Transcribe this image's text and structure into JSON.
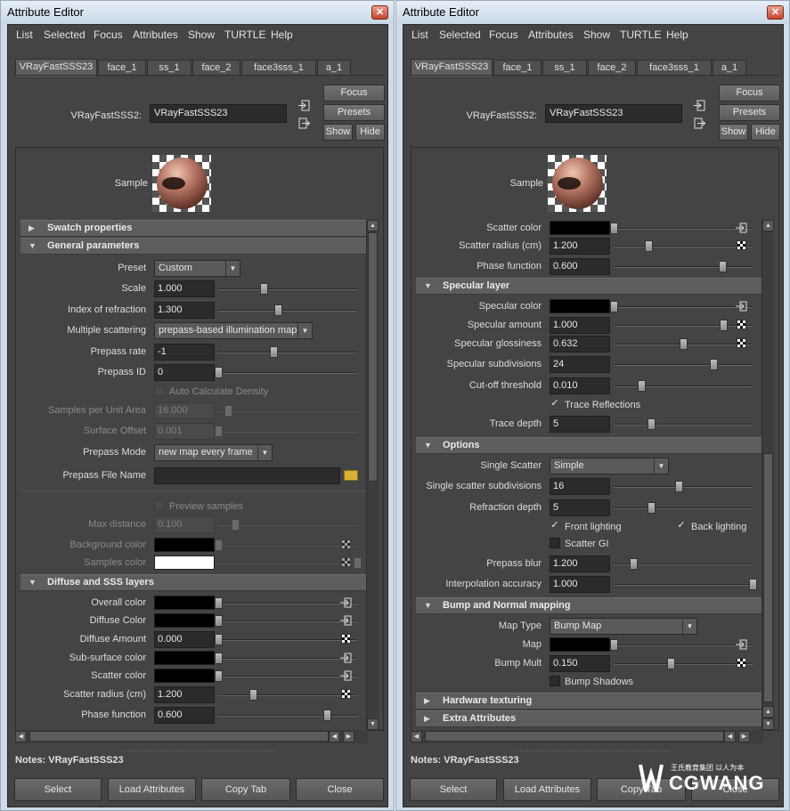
{
  "window_title": "Attribute Editor",
  "close_glyph": "✕",
  "menu": [
    "List",
    "Selected",
    "Focus",
    "Attributes",
    "Show",
    "TURTLE",
    "Help"
  ],
  "tabs": [
    "VRayFastSSS23",
    "face_1",
    "ss_1",
    "face_2",
    "face3sss_1",
    "a_1"
  ],
  "node_label": "VRayFastSSS2:",
  "node_name": "VRayFastSSS23",
  "buttons": {
    "focus": "Focus",
    "presets": "Presets",
    "show": "Show",
    "hide": "Hide"
  },
  "sample_label": "Sample",
  "notes": "Notes:  VRayFastSSS23",
  "bottom": [
    "Select",
    "Load Attributes",
    "Copy Tab",
    "Close"
  ],
  "left": {
    "sections": {
      "swatch": "Swatch properties",
      "general": "General parameters",
      "diffuse": "Diffuse and SSS layers"
    },
    "preset": {
      "label": "Preset",
      "value": "Custom"
    },
    "scale": {
      "label": "Scale",
      "value": "1.000",
      "level": 0.33
    },
    "ior": {
      "label": "Index of refraction",
      "value": "1.300",
      "level": 0.43
    },
    "multiple_scattering": {
      "label": "Multiple scattering",
      "value": "prepass-based illumination map"
    },
    "prepass_rate": {
      "label": "Prepass rate",
      "value": "-1",
      "level": 0.4
    },
    "prepass_id": {
      "label": "Prepass ID",
      "value": "0",
      "level": 0.0
    },
    "auto_calc": {
      "label": "Auto Calculate Density"
    },
    "samples_per_unit": {
      "label": "Samples per Unit Area",
      "value": "16.000",
      "level": 0.07
    },
    "surface_offset": {
      "label": "Surface Offset",
      "value": "0.001",
      "level": 0.0
    },
    "prepass_mode": {
      "label": "Prepass Mode",
      "value": "new map every frame"
    },
    "prepass_file": {
      "label": "Prepass File Name",
      "value": ""
    },
    "preview_samples": {
      "label": "Preview samples"
    },
    "max_distance": {
      "label": "Max distance",
      "value": "0.100",
      "level": 0.12
    },
    "background_color": {
      "label": "Background color",
      "color": "#000000"
    },
    "samples_color": {
      "label": "Samples color",
      "color": "#ffffff"
    },
    "overall_color": {
      "label": "Overall color",
      "color": "#000000"
    },
    "diffuse_color": {
      "label": "Diffuse Color",
      "color": "#000000"
    },
    "diffuse_amount": {
      "label": "Diffuse Amount",
      "value": "0.000",
      "level": 0.0
    },
    "subsurface_color": {
      "label": "Sub-surface color",
      "color": "#000000"
    },
    "scatter_color": {
      "label": "Scatter color",
      "color": "#000000"
    },
    "scatter_radius": {
      "label": "Scatter radius (cm)",
      "value": "1.200",
      "level": 0.25
    },
    "phase_function": {
      "label": "Phase function",
      "value": "0.600",
      "level": 0.78
    }
  },
  "right": {
    "sections": {
      "specular": "Specular layer",
      "options": "Options",
      "bump": "Bump and Normal mapping",
      "hardware": "Hardware texturing",
      "extra": "Extra Attributes"
    },
    "scatter_color": {
      "label": "Scatter color",
      "color": "#000000"
    },
    "scatter_radius": {
      "label": "Scatter radius (cm)",
      "value": "1.200",
      "level": 0.25
    },
    "phase_function": {
      "label": "Phase function",
      "value": "0.600",
      "level": 0.78
    },
    "specular_color": {
      "label": "Specular color",
      "color": "#000000"
    },
    "specular_amount": {
      "label": "Specular amount",
      "value": "1.000",
      "level": 0.79
    },
    "specular_glossiness": {
      "label": "Specular glossiness",
      "value": "0.632",
      "level": 0.5
    },
    "specular_subdivisions": {
      "label": "Specular subdivisions",
      "value": "24",
      "level": 0.72
    },
    "cutoff": {
      "label": "Cut-off threshold",
      "value": "0.010",
      "level": 0.2
    },
    "trace_reflections": {
      "label": "Trace Reflections",
      "checked": "✓"
    },
    "trace_depth": {
      "label": "Trace depth",
      "value": "5",
      "level": 0.27
    },
    "single_scatter": {
      "label": "Single Scatter",
      "value": "Simple"
    },
    "single_scatter_subdiv": {
      "label": "Single scatter subdivisions",
      "value": "16",
      "level": 0.47
    },
    "refraction_depth": {
      "label": "Refraction depth",
      "value": "5",
      "level": 0.27
    },
    "front_lighting": {
      "label": "Front lighting",
      "checked": "✓"
    },
    "back_lighting": {
      "label": "Back lighting",
      "checked": "✓"
    },
    "scatter_gi": {
      "label": "Scatter GI"
    },
    "prepass_blur": {
      "label": "Prepass blur",
      "value": "1.200",
      "level": 0.14
    },
    "interp_accuracy": {
      "label": "Interpolation accuracy",
      "value": "1.000",
      "level": 1.0
    },
    "map_type": {
      "label": "Map Type",
      "value": "Bump Map"
    },
    "map": {
      "label": "Map",
      "color": "#000000"
    },
    "bump_mult": {
      "label": "Bump Mult",
      "value": "0.150",
      "level": 0.41
    },
    "bump_shadows": {
      "label": "Bump Shadows"
    }
  },
  "watermark": {
    "small_text": "王氏教育集团 以人为本",
    "brand": "CGWANG"
  },
  "colors": {
    "panel_bg": "#444444",
    "title_bg": "#cfdbe8",
    "section_bg": "#5d5d5d"
  }
}
